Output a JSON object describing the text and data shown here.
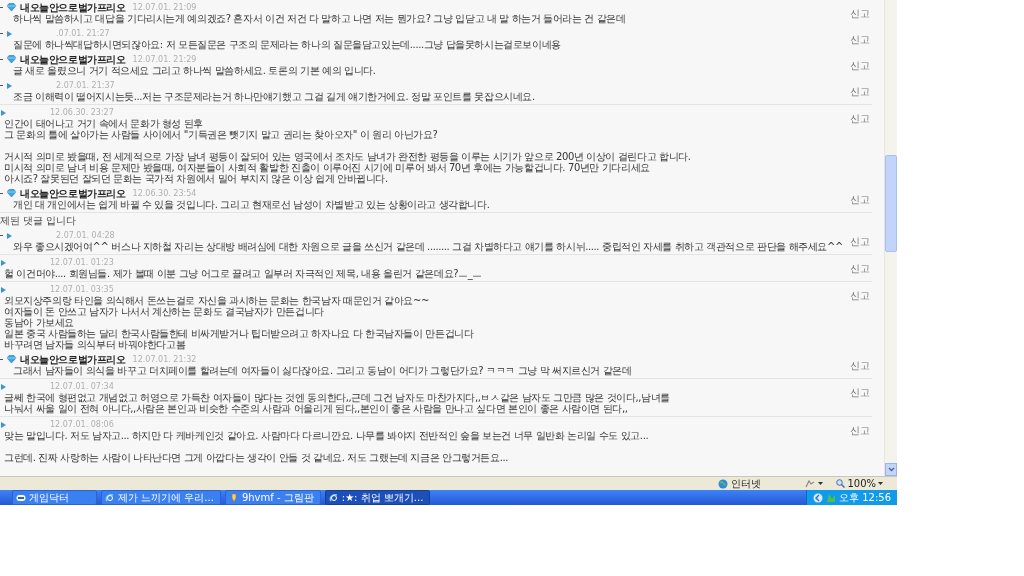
{
  "comments": [
    {
      "kind": "reply",
      "author": "내오늘안으로벌가프리오",
      "date": "12.07.01. 21:09",
      "paragraphs": [
        [
          "하나씩 말씀하시고 대답을 기다리시는게 예의겠죠? 혼자서 이건 저건 다 말하고 나면 저는 뭔가요? 그냥 입닫고 내 말 하는거 들어라는 건 같은데"
        ]
      ],
      "report": "신고"
    },
    {
      "kind": "reply",
      "date": ".07.01. 21:27",
      "paragraphs": [
        [
          "질문에 하나씩대답하시면되잖아요: 저 모든질문은 구조의 문제라는 하나의 질문을담고있는데.....그냥 답을못하시는걸로보이네용"
        ]
      ],
      "report": "신고"
    },
    {
      "kind": "reply",
      "author": "내오늘안으로벌가프리오",
      "date": "12.07.01. 21:29",
      "paragraphs": [
        [
          "글 새로 올렸으니 거기 적으세요 그리고 하나씩 말씀하세요. 토론의 기본 예의 입니다."
        ]
      ],
      "report": "신고"
    },
    {
      "kind": "reply",
      "date": "2.07.01. 21:37",
      "paragraphs": [
        [
          "조금 이해력이 떨어지시는듯...저는 구조문제라는거 하나만얘기했고 그걸 길게 얘기한거에요. 정말 포인트를 못잡으시네요."
        ]
      ],
      "report": "신고"
    },
    {
      "kind": "post",
      "date": "12.06.30. 23:27",
      "paragraphs": [
        [
          "인간이 태어나고 거기 속에서 문화가 형성 된후",
          "그 문화의 틀에 살아가는 사람들 사이에서 \"기득권은 뺏기지 말고 권리는 찾아오자\" 이 원리 아닌가요?"
        ],
        [
          "거시적 의미로 봤을때, 전 세계적으로 가장 남녀 평등이 잘되어 있는 영국에서 조차도 남녀가 완전한 평등을 이루는 시기가 앞으로 200년 이상이 걸린다고 합니다.",
          "미시적 의미로 남녀 비용 문제만 봤을때, 여자분들이 사회적 활발한 진출이 이루어진 시기에 미루어 봐서 70년 후에는 가능할겁니다. 70년만 기다리세요",
          "아시죠? 잘못된던 잘되던 문화는 국가적 차원에서 밀어 부치지 않은 이상 쉽게 안바뀝니다."
        ]
      ],
      "report": "신고"
    },
    {
      "kind": "reply",
      "author": "내오늘안으로벌가프리오",
      "date": "12.06.30. 23:54",
      "paragraphs": [
        [
          "개인 대 개인에서는 쉽게 바뀔 수 있을 것입니다. 그리고 현재로선 남성이 차별받고 있는 상황이라고 생각합니다."
        ]
      ],
      "report": "신고"
    },
    {
      "kind": "deleted",
      "notice": "제된 댓글 입니다"
    },
    {
      "kind": "reply",
      "date": "2.07.01. 04:28",
      "paragraphs": [
        [
          "와우 좋으시겠어여^^ 버스나 지하철 자리는 상대방 배려심에 대한 차원으로 글을 쓰신거 같은데 ........ 그걸 차별하다고 얘기를 하시뉘..... 중립적인 자세를 취하고 객관적으로 판단을 해주세요^^"
        ]
      ],
      "report": "신고"
    },
    {
      "kind": "post",
      "date": "12.07.01. 01:23",
      "paragraphs": [
        [
          "헐 이건머야.... 회원님들. 제가 볼때 이분 그냥 어그로 끌려고 일부러 자극적인 제목, 내용 올린거 같은데요?ㅡ_ㅡ"
        ]
      ],
      "report": "신고"
    },
    {
      "kind": "post",
      "date": "12.07.01. 03:35",
      "paragraphs": [
        [
          "외모지상주의랑 타인을 의식해서 돈쓰는걸로 자신을 과시하는 문화는 한국남자 때문인거 같아요~~",
          "여자들이 돈 안쓰고 남자가 나서서 계산하는 문화도 결국남자가 만든겁니다",
          "동남아 가보세요",
          "일본 중국 사람들하는 달리 한국사람들한테 비싸게받거나 팁더받으려고 하자나요 다 한국남자들이 만든겁니다",
          "바꾸려면 남자들 의식부터 바꿔야한다고봄"
        ]
      ],
      "report": "신고"
    },
    {
      "kind": "reply",
      "author": "내오늘안으로벌가프리오",
      "date": "12.07.01. 21:32",
      "paragraphs": [
        [
          "그래서 남자들이 의식을 바꾸고 더치페이를 할려는데 여자들이 싫다잖아요. 그리고 동남이 어디가 그렇단가요? ㅋㅋㅋ 그냥 막 써지르신거 같은데"
        ]
      ],
      "report": "신고"
    },
    {
      "kind": "post",
      "date": "12.07.01. 07:34",
      "paragraphs": [
        [
          "글쎄 한국에 형편없고 개념없고 허영으로 가득찬 여자들이 많다는 것엔 동의한다,,근데 그건 남자도 마찬가지다,,ㅂㅅ같은 남자도 그만큼 많은 것이다,,남녀를",
          "나눠서 싸울 일이 전혀 아니다,,사람은 본인과 비슷한 수준의 사람과 어울리게 된다,,본인이 좋은 사람을 만나고 싶다면 본인이 좋은 사람이면 된다,,"
        ]
      ],
      "report": "신고"
    },
    {
      "kind": "post",
      "date": "12.07.01. 08:06",
      "paragraphs": [
        [
          "맞는 말입니다. 저도 남자고... 하지만 다 케바케인것 같아요. 사람마다 다르니깐요. 나무를 봐야지 전반적인 숲을 보는건 너무 일반화 논리일 수도 있고..."
        ],
        [
          "그런데. 진짜 사랑하는 사람이 나타난다면 그게 아깝다는 생각이 안들 것 같네요. 저도 그랬는데 지금은 안그렇거든요..."
        ]
      ],
      "report": "신고"
    }
  ],
  "status_bar": {
    "zone": "인터넷",
    "zoom": "100%"
  },
  "taskbar": {
    "items": [
      {
        "label": "게임닥터",
        "kind": "game",
        "selected": false
      },
      {
        "label": "제가 느끼기에 우리...",
        "kind": "browser",
        "selected": false
      },
      {
        "label": "9hvmf - 그림판",
        "kind": "paint",
        "selected": false
      },
      {
        "label": ":★: 취업 뽀개기...",
        "kind": "browser",
        "selected": true
      }
    ],
    "clock": "오후 12:56"
  }
}
